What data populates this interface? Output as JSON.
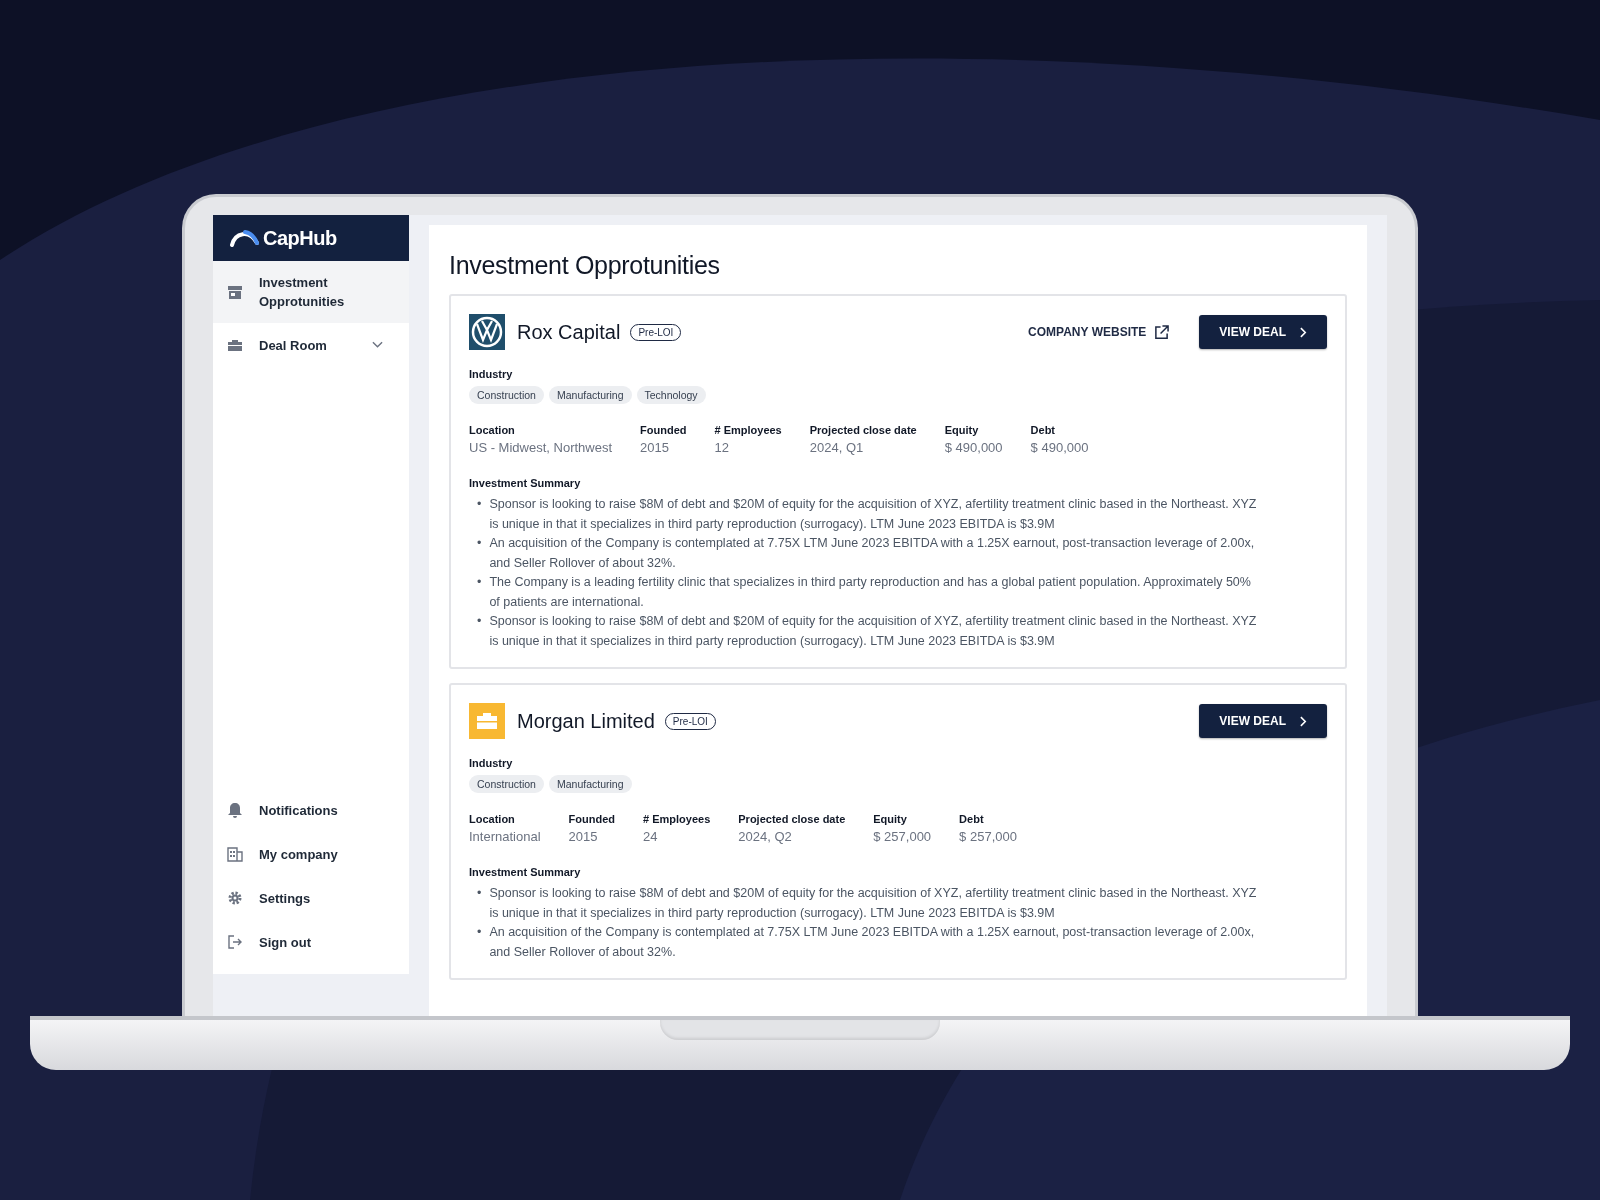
{
  "sidebar": {
    "logo": "CapHub",
    "items": [
      {
        "label": "Investment Opprotunities",
        "selected": true
      },
      {
        "label": "Deal Room",
        "selected": false,
        "expanded": false
      }
    ],
    "bottom_items": [
      {
        "label": "Notifications"
      },
      {
        "label": "My company"
      },
      {
        "label": "Settings"
      },
      {
        "label": "Sign out"
      }
    ]
  },
  "page_title": "Investment Opprotunities",
  "deals": [
    {
      "kind": "emblem",
      "name": "Rox Capital",
      "badge": "Pre-LOI",
      "bullet_mark": "•",
      "website_link": "COMPANY WEBSITE",
      "button": "VIEW DEAL",
      "industry_label": "Industry",
      "tags": [
        "Construction",
        "Manufacturing",
        "Technology"
      ],
      "facts": [
        {
          "label": "Location",
          "value": "US - Midwest, Northwest"
        },
        {
          "label": "Founded",
          "value": "2015"
        },
        {
          "label": "# Employees",
          "value": "12"
        },
        {
          "label": "Projected close date",
          "value": "2024, Q1"
        },
        {
          "label": "Equity",
          "value": "$ 490,000"
        },
        {
          "label": "Debt",
          "value": "$ 490,000"
        }
      ],
      "summary_title": "Investment Summary",
      "summary": [
        "Sponsor is looking to raise $8M of debt and $20M of equity for the acquisition of XYZ, afertility treatment clinic based in the Northeast. XYZ is unique in that it specializes in third party reproduction (surrogacy). LTM June 2023 EBITDA is $3.9M",
        "An acquisition of the Company is contemplated at 7.75X LTM June 2023 EBITDA with a 1.25X earnout, post-transaction leverage of 2.00x, and Seller Rollover of about 32%.",
        "The Company is a leading fertility clinic that specializes in third party reproduction and has a global patient population. Approximately 50% of patients are international.",
        "Sponsor is looking to raise $8M of debt and $20M of equity for the acquisition of XYZ, afertility treatment clinic based in the Northeast. XYZ is unique in that it specializes in third party reproduction (surrogacy). LTM June 2023 EBITDA is $3.9M"
      ]
    },
    {
      "kind": "briefcase",
      "name": "Morgan Limited",
      "badge": "Pre-LOI",
      "bullet_mark": "•",
      "button": "VIEW DEAL",
      "industry_label": "Industry",
      "tags": [
        "Construction",
        "Manufacturing"
      ],
      "facts": [
        {
          "label": "Location",
          "value": "International"
        },
        {
          "label": "Founded",
          "value": "2015"
        },
        {
          "label": "# Employees",
          "value": "24"
        },
        {
          "label": "Projected close date",
          "value": "2024, Q2"
        },
        {
          "label": "Equity",
          "value": "$ 257,000"
        },
        {
          "label": "Debt",
          "value": "$ 257,000"
        }
      ],
      "summary_title": "Investment Summary",
      "summary": [
        "Sponsor is looking to raise $8M of debt and $20M of equity for the acquisition of XYZ, afertility treatment clinic based in the Northeast. XYZ is unique in that it specializes in third party reproduction (surrogacy). LTM June 2023 EBITDA is $3.9M",
        "An acquisition of the Company is contemplated at 7.75X LTM June 2023 EBITDA with a 1.25X earnout, post-transaction leverage of 2.00x, and Seller Rollover of about 32%."
      ]
    }
  ]
}
